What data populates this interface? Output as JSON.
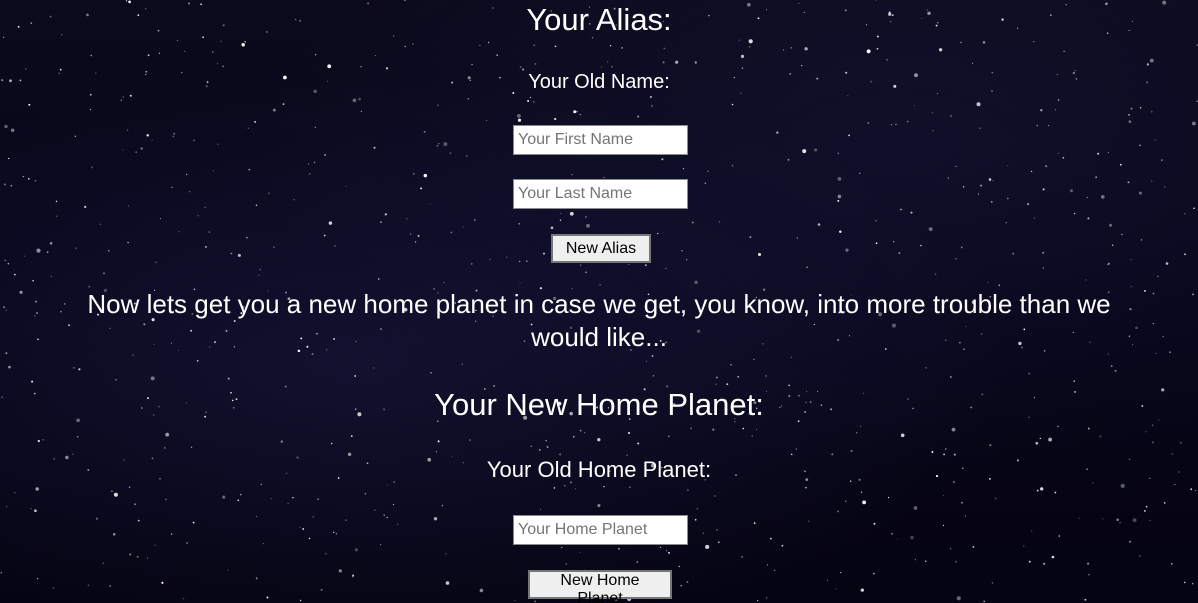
{
  "alias_section": {
    "heading": "Your Alias:",
    "old_name_label": "Your Old Name:",
    "first_name_placeholder": "Your First Name",
    "first_name_value": "",
    "last_name_placeholder": "Your Last Name",
    "last_name_value": "",
    "button_label": "New Alias"
  },
  "intro_text": "Now lets get you a new home planet in case we get, you know, into more trouble than we would like...",
  "planet_section": {
    "heading": "Your New Home Planet:",
    "old_planet_label": "Your Old Home Planet:",
    "home_planet_placeholder": "Your Home Planet",
    "home_planet_value": "",
    "button_label": "New Home Planet"
  },
  "colors": {
    "background": "#07061a",
    "text": "#ffffff",
    "button_face": "#efefef",
    "button_border": "#767676"
  }
}
